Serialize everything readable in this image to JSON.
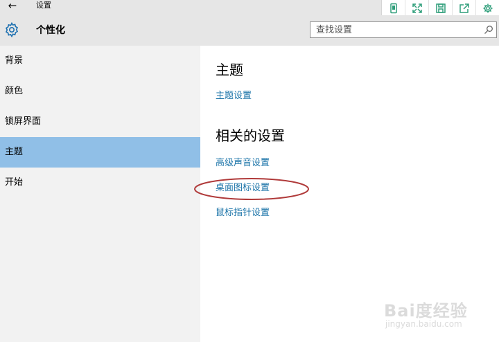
{
  "window": {
    "title": "设置"
  },
  "header": {
    "page_title": "个性化"
  },
  "search": {
    "placeholder": "查找设置"
  },
  "sidebar": {
    "items": [
      {
        "label": "背景",
        "active": false
      },
      {
        "label": "颜色",
        "active": false
      },
      {
        "label": "锁屏界面",
        "active": false
      },
      {
        "label": "主题",
        "active": true
      },
      {
        "label": "开始",
        "active": false
      }
    ]
  },
  "main": {
    "theme_heading": "主题",
    "theme_settings_link": "主题设置",
    "related_heading": "相关的设置",
    "related_links": [
      "高级声音设置",
      "桌面图标设置",
      "鼠标指针设置"
    ]
  },
  "toolbar": {
    "icons": [
      "phone-icon",
      "expand-icon",
      "save-icon",
      "share-icon",
      "gear-icon"
    ]
  },
  "watermark": {
    "main": "Bai度经验",
    "sub": "jingyan.baidu.com"
  },
  "colors": {
    "accent_selected": "#90bfe7",
    "link": "#1a73a8",
    "highlight_circle": "#b03a3a",
    "toolbar_icon": "#2e9e7a"
  }
}
